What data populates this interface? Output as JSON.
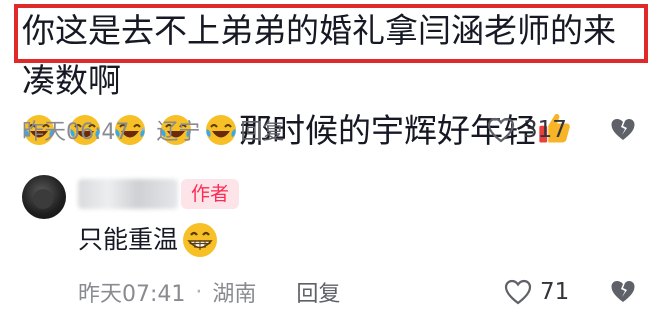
{
  "main_comment": {
    "text": "你这是去不上弟弟的婚礼拿闫涵老师的来凑数啊",
    "emoji_icons": [
      "laughing-tears-icon",
      "laughing-tears-icon",
      "laughing-tears-icon",
      "laughing-tears-icon",
      "laughing-tears-icon"
    ],
    "text_line2": "那时候的宇辉好年轻",
    "thumbs_icon": "thumbs-up-icon",
    "time": "昨天06:47",
    "separator": "·",
    "region": "辽宁",
    "reply_label": "回复",
    "like_count": "317"
  },
  "reply_comment": {
    "author_badge": "作者",
    "text": "只能重温",
    "emoji_icon": "grinning-face-icon",
    "time": "昨天07:41",
    "separator": "·",
    "region": "湖南",
    "reply_label": "回复",
    "like_count": "71"
  },
  "colors": {
    "highlight": "#e02a2a",
    "meta_text": "#8a8b91",
    "badge_text": "#fe2c55",
    "badge_bg": "#fde4e8"
  }
}
